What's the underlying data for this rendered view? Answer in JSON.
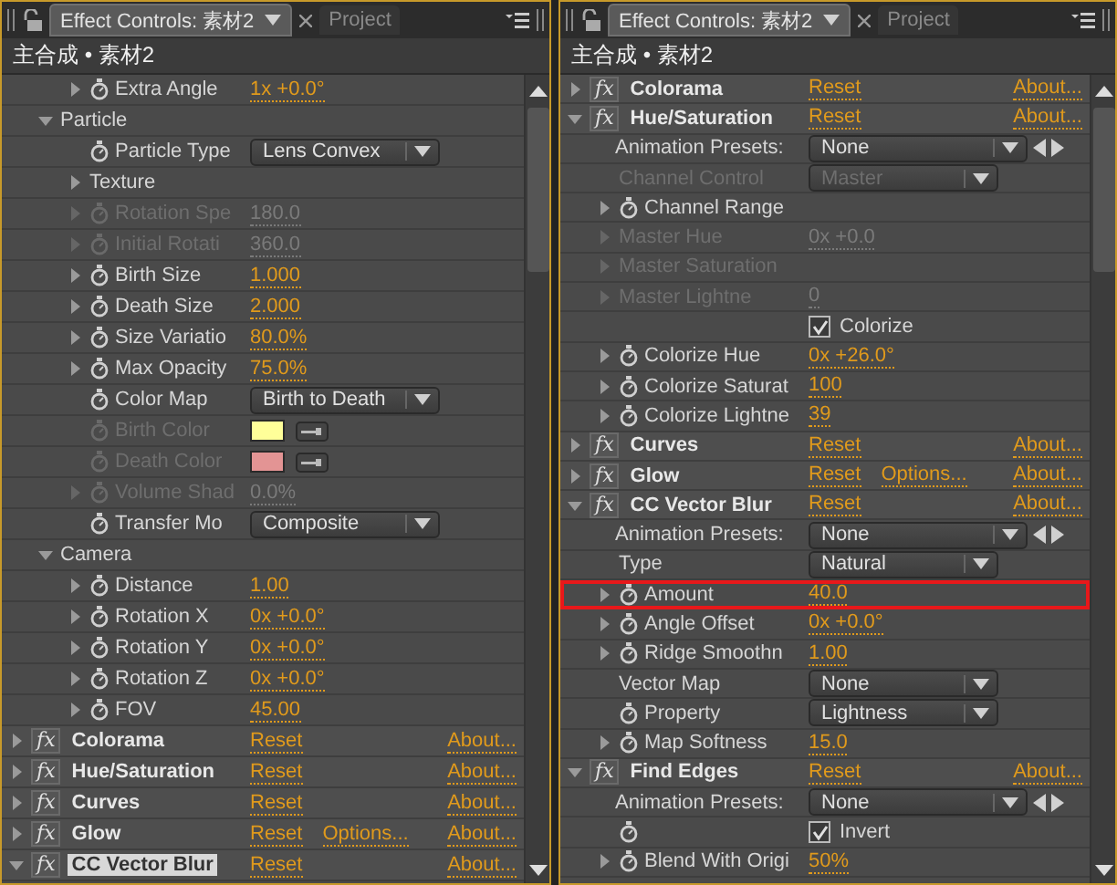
{
  "panels": [
    {
      "tabs": [
        {
          "label": "Effect Controls: 素材2",
          "selected": true
        },
        {
          "label": "Project",
          "selected": false
        }
      ],
      "breadcrumb": "主合成 • 素材2",
      "items": [
        {
          "kind": "effect",
          "children": [
            {
              "kind": "group",
              "children": [
                {
                  "kind": "value",
                  "label": "Extra Angle",
                  "expanded": false,
                  "stopwatch": true,
                  "disabled": false,
                  "value": "1x +0.0°"
                }
              ]
            },
            {
              "kind": "group",
              "label": "Particle",
              "expanded": true,
              "children": [
                {
                  "kind": "dropdown",
                  "label": "Particle Type",
                  "stopwatch": true,
                  "disabled": false,
                  "value": "Lens Convex"
                },
                {
                  "kind": "group",
                  "label": "Texture",
                  "expanded": false
                },
                {
                  "kind": "value",
                  "label": "Rotation Spe",
                  "expanded": false,
                  "stopwatch": true,
                  "disabled": true,
                  "value": "180.0"
                },
                {
                  "kind": "value",
                  "label": "Initial Rotati",
                  "expanded": false,
                  "stopwatch": true,
                  "disabled": true,
                  "value": "360.0"
                },
                {
                  "kind": "value",
                  "label": "Birth Size",
                  "expanded": false,
                  "stopwatch": true,
                  "disabled": false,
                  "value": "1.000"
                },
                {
                  "kind": "value",
                  "label": "Death Size",
                  "expanded": false,
                  "stopwatch": true,
                  "disabled": false,
                  "value": "2.000"
                },
                {
                  "kind": "value",
                  "label": "Size Variatio",
                  "expanded": false,
                  "stopwatch": true,
                  "disabled": false,
                  "value": "80.0%"
                },
                {
                  "kind": "value",
                  "label": "Max Opacity",
                  "expanded": false,
                  "stopwatch": true,
                  "disabled": false,
                  "value": "75.0%"
                },
                {
                  "kind": "dropdown",
                  "label": "Color Map",
                  "stopwatch": true,
                  "disabled": false,
                  "value": "Birth to Death"
                },
                {
                  "kind": "swatch",
                  "label": "Birth Color",
                  "stopwatch": true,
                  "disabled": true,
                  "color": "#ffff99"
                },
                {
                  "kind": "swatch",
                  "label": "Death Color",
                  "stopwatch": true,
                  "disabled": true,
                  "color": "#e39494"
                },
                {
                  "kind": "value",
                  "label": "Volume Shad",
                  "expanded": false,
                  "stopwatch": true,
                  "disabled": true,
                  "value": "0.0%"
                },
                {
                  "kind": "dropdown",
                  "label": "Transfer Mo",
                  "stopwatch": true,
                  "disabled": false,
                  "value": "Composite"
                }
              ]
            },
            {
              "kind": "group",
              "label": "Camera",
              "expanded": true,
              "children": [
                {
                  "kind": "value",
                  "label": "Distance",
                  "expanded": false,
                  "stopwatch": true,
                  "disabled": false,
                  "value": "1.00"
                },
                {
                  "kind": "value",
                  "label": "Rotation X",
                  "expanded": false,
                  "stopwatch": true,
                  "disabled": false,
                  "value": "0x +0.0°"
                },
                {
                  "kind": "value",
                  "label": "Rotation Y",
                  "expanded": false,
                  "stopwatch": true,
                  "disabled": false,
                  "value": "0x +0.0°"
                },
                {
                  "kind": "value",
                  "label": "Rotation Z",
                  "expanded": false,
                  "stopwatch": true,
                  "disabled": false,
                  "value": "0x +0.0°"
                },
                {
                  "kind": "value",
                  "label": "FOV",
                  "expanded": false,
                  "stopwatch": true,
                  "disabled": false,
                  "value": "45.00"
                }
              ]
            }
          ]
        },
        {
          "kind": "effect",
          "icon": "fx",
          "label": "Colorama",
          "expanded": false,
          "selected": false,
          "reset": "Reset",
          "about": "About..."
        },
        {
          "kind": "effect",
          "icon": "fx",
          "label": "Hue/Saturation",
          "expanded": false,
          "selected": false,
          "reset": "Reset",
          "about": "About..."
        },
        {
          "kind": "effect",
          "icon": "fx",
          "label": "Curves",
          "expanded": false,
          "selected": false,
          "reset": "Reset",
          "about": "About..."
        },
        {
          "kind": "effect",
          "icon": "fx",
          "label": "Glow",
          "expanded": false,
          "selected": false,
          "reset": "Reset",
          "options": "Options...",
          "about": "About..."
        },
        {
          "kind": "effect",
          "icon": "fx",
          "label": "CC Vector Blur",
          "expanded": true,
          "selected": true,
          "reset": "Reset",
          "about": "About..."
        }
      ]
    },
    {
      "tabs": [
        {
          "label": "Effect Controls: 素材2",
          "selected": true
        },
        {
          "label": "Project",
          "selected": false
        }
      ],
      "breadcrumb": "主合成 • 素材2",
      "items": [
        {
          "kind": "effect",
          "icon": "fx",
          "label": "Colorama",
          "expanded": false,
          "selected": false,
          "reset": "Reset",
          "about": "About..."
        },
        {
          "kind": "effect",
          "icon": "fx",
          "label": "Hue/Saturation",
          "expanded": true,
          "selected": false,
          "reset": "Reset",
          "about": "About...",
          "children": [
            {
              "kind": "presets",
              "label": "Animation Presets:",
              "value": "None"
            },
            {
              "kind": "dropdown",
              "label": "Channel Control",
              "disabled": true,
              "value": "Master"
            },
            {
              "kind": "value",
              "label": "Channel Range",
              "expanded": false,
              "stopwatch": true,
              "disabled": false
            },
            {
              "kind": "value",
              "label": "Master Hue",
              "expanded": false,
              "disabled": true,
              "value": "0x +0.0"
            },
            {
              "kind": "value",
              "label": "Master Saturation",
              "expanded": false,
              "disabled": true
            },
            {
              "kind": "value",
              "label": "Master Lightne",
              "expanded": false,
              "disabled": true,
              "value": "0"
            },
            {
              "kind": "checkbox",
              "checked": true,
              "text": "Colorize"
            },
            {
              "kind": "value",
              "label": "Colorize Hue",
              "expanded": false,
              "stopwatch": true,
              "disabled": false,
              "value": "0x +26.0°"
            },
            {
              "kind": "value",
              "label": "Colorize Saturat",
              "expanded": false,
              "stopwatch": true,
              "disabled": false,
              "value": "100"
            },
            {
              "kind": "value",
              "label": "Colorize Lightne",
              "expanded": false,
              "stopwatch": true,
              "disabled": false,
              "value": "39"
            }
          ]
        },
        {
          "kind": "effect",
          "icon": "fx",
          "label": "Curves",
          "expanded": false,
          "selected": false,
          "reset": "Reset",
          "about": "About..."
        },
        {
          "kind": "effect",
          "icon": "fx",
          "label": "Glow",
          "expanded": false,
          "selected": false,
          "reset": "Reset",
          "options": "Options...",
          "about": "About..."
        },
        {
          "kind": "effect",
          "icon": "fx",
          "label": "CC Vector Blur",
          "expanded": true,
          "selected": false,
          "reset": "Reset",
          "about": "About...",
          "children": [
            {
              "kind": "presets",
              "label": "Animation Presets:",
              "value": "None"
            },
            {
              "kind": "dropdown",
              "label": "Type",
              "disabled": false,
              "value": "Natural"
            },
            {
              "kind": "value",
              "label": "Amount",
              "expanded": false,
              "stopwatch": true,
              "disabled": false,
              "highlighted": true,
              "value": "40.0"
            },
            {
              "kind": "value",
              "label": "Angle Offset",
              "expanded": false,
              "stopwatch": true,
              "disabled": false,
              "value": "0x +0.0°"
            },
            {
              "kind": "value",
              "label": "Ridge Smoothn",
              "expanded": false,
              "stopwatch": true,
              "disabled": false,
              "value": "1.00"
            },
            {
              "kind": "dropdown",
              "label": "Vector Map",
              "disabled": false,
              "value": "None"
            },
            {
              "kind": "dropdown",
              "label": "Property",
              "stopwatch": true,
              "disabled": false,
              "value": "Lightness"
            },
            {
              "kind": "value",
              "label": "Map Softness",
              "expanded": false,
              "stopwatch": true,
              "disabled": false,
              "value": "15.0"
            }
          ]
        },
        {
          "kind": "effect",
          "icon": "fx",
          "label": "Find Edges",
          "expanded": true,
          "selected": false,
          "reset": "Reset",
          "about": "About...",
          "children": [
            {
              "kind": "presets",
              "label": "Animation Presets:",
              "value": "None"
            },
            {
              "kind": "checkbox",
              "stopwatch": true,
              "checked": true,
              "text": "Invert"
            },
            {
              "kind": "value",
              "label": "Blend With Origi",
              "expanded": false,
              "stopwatch": true,
              "disabled": false,
              "value": "50%"
            }
          ]
        }
      ]
    }
  ]
}
